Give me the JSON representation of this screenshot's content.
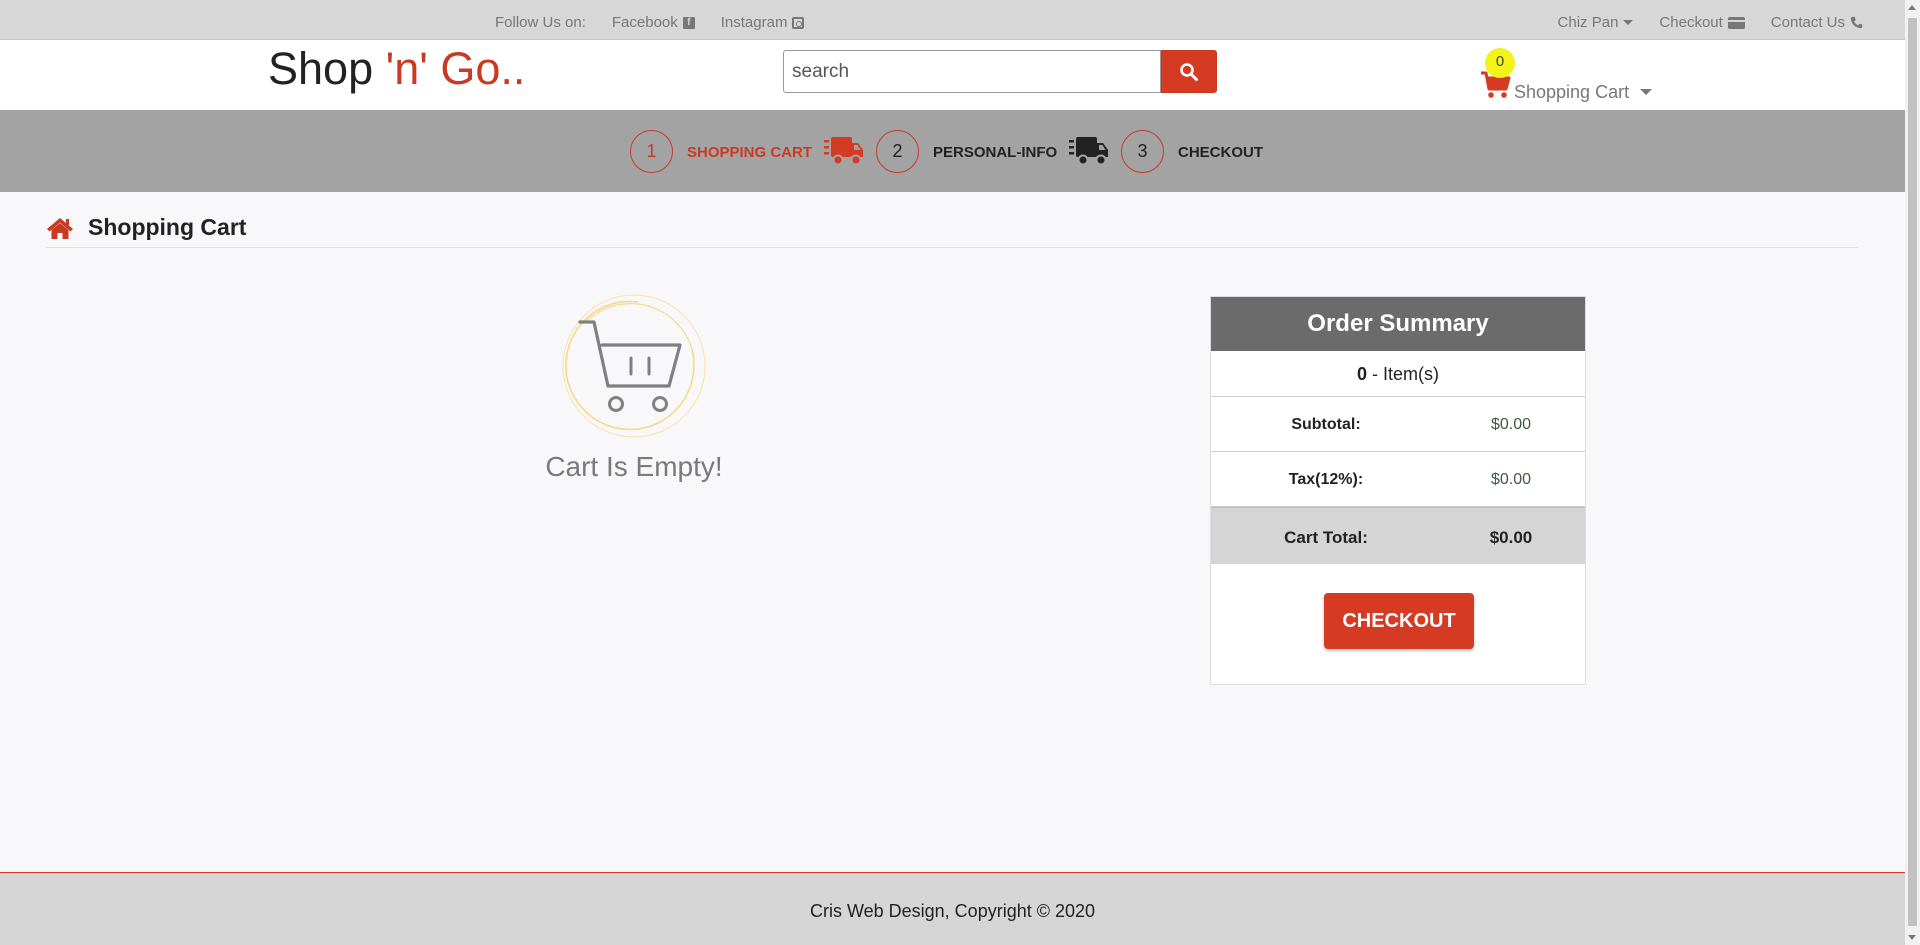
{
  "topbar": {
    "follow_label": "Follow Us on:",
    "facebook": "Facebook",
    "instagram": "Instagram",
    "user": "Chiz Pan",
    "checkout": "Checkout",
    "contact": "Contact Us"
  },
  "header": {
    "logo_main": "Shop ",
    "logo_accent": "'n' Go..",
    "search_placeholder": "search",
    "cart_count": "0",
    "cart_label": "Shopping Cart"
  },
  "steps": [
    {
      "number": "1",
      "label": "SHOPPING CART",
      "active": true
    },
    {
      "number": "2",
      "label": "PERSONAL-INFO",
      "active": false
    },
    {
      "number": "3",
      "label": "CHECKOUT",
      "active": false
    }
  ],
  "page": {
    "title": "Shopping Cart",
    "empty_message": "Cart Is Empty!"
  },
  "summary": {
    "title": "Order Summary",
    "item_count": "0",
    "item_suffix": " - Item(s)",
    "subtotal_label": "Subtotal:",
    "subtotal_value": "$0.00",
    "tax_label": "Tax(12%):",
    "tax_value": "$0.00",
    "total_label": "Cart Total:",
    "total_value": "$0.00",
    "checkout_button": "CHECKOUT"
  },
  "footer": {
    "text": "Cris Web Design, Copyright © 2020"
  },
  "colors": {
    "accent": "#d53a22",
    "topbar_bg": "#d7d7d7",
    "steps_bg": "#a3a3a3",
    "summary_header_bg": "#6b6b6b",
    "badge": "#f3f31a"
  }
}
